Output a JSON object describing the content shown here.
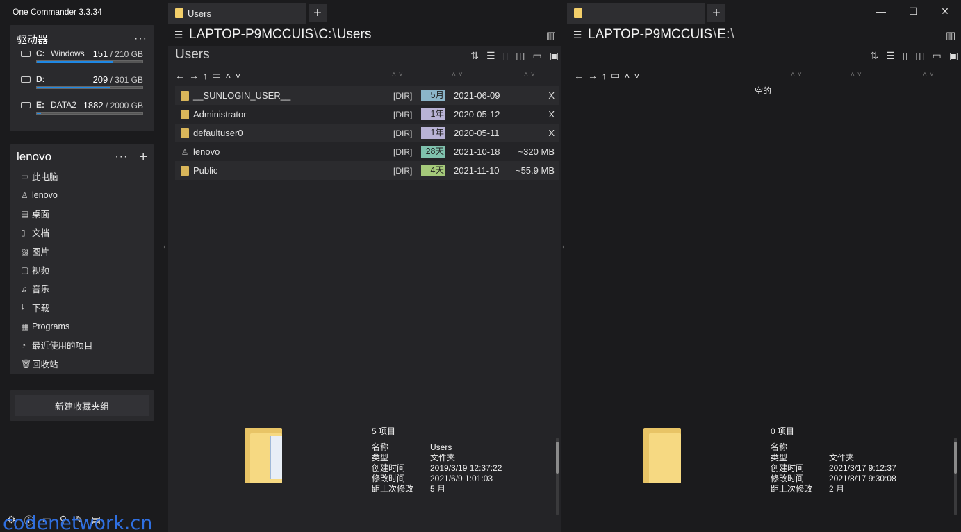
{
  "app": {
    "title": "One Commander 3.3.34"
  },
  "window_controls": {
    "minimize": "—",
    "maximize": "☐",
    "close": "✕"
  },
  "sidebar": {
    "drives_title": "驱动器",
    "drives_menu": "···",
    "drives": [
      {
        "letter": "C:",
        "label": "Windows",
        "used": "151",
        "total": "/ 210 GB",
        "fill": 0.72
      },
      {
        "letter": "D:",
        "label": "",
        "used": "209",
        "total": "/ 301 GB",
        "fill": 0.69
      },
      {
        "letter": "E:",
        "label": "DATA2",
        "used": "1882",
        "total": "/ 2000 GB",
        "fill": 0.04
      }
    ],
    "favorites_title": "lenovo",
    "favorites_menu": "···",
    "favorites_add": "+",
    "favorites": [
      {
        "icon": "computer-icon",
        "glyph": "▭",
        "label": "此电脑"
      },
      {
        "icon": "user-icon",
        "glyph": "♙",
        "label": "lenovo"
      },
      {
        "icon": "desktop-icon",
        "glyph": "▤",
        "label": "桌面"
      },
      {
        "icon": "document-icon",
        "glyph": "▯",
        "label": "文档"
      },
      {
        "icon": "picture-icon",
        "glyph": "▨",
        "label": "图片"
      },
      {
        "icon": "video-icon",
        "glyph": "▢",
        "label": "视频"
      },
      {
        "icon": "music-icon",
        "glyph": "♫",
        "label": "音乐"
      },
      {
        "icon": "download-icon",
        "glyph": "⤓",
        "label": "下载"
      },
      {
        "icon": "programs-icon",
        "glyph": "▦",
        "label": "Programs"
      },
      {
        "icon": "recent-icon",
        "glyph": "◔",
        "label": "最近使用的项目"
      },
      {
        "icon": "recycle-bin-icon",
        "glyph": "🗑",
        "label": "回收站"
      }
    ],
    "new_group": "新建收藏夹组"
  },
  "left_pane": {
    "tab_label": "Users",
    "tab_add": "+",
    "path_host": "LAPTOP-P9MCCUIS",
    "path_sep1": "\\",
    "path_drive": "C:",
    "path_sep2": "\\",
    "path_folder": "Users",
    "current_dir": "Users",
    "rows": [
      {
        "name": "__SUNLOGIN_USER__",
        "type": "[DIR]",
        "age": "5月",
        "age_color": "#8bb5c9",
        "date": "2021-06-09",
        "size": "X",
        "kind": "folder"
      },
      {
        "name": "Administrator",
        "type": "[DIR]",
        "age": "1年",
        "age_color": "#b9b3d6",
        "date": "2020-05-12",
        "size": "X",
        "kind": "folder"
      },
      {
        "name": "defaultuser0",
        "type": "[DIR]",
        "age": "1年",
        "age_color": "#b9b3d6",
        "date": "2020-05-11",
        "size": "X",
        "kind": "folder"
      },
      {
        "name": "lenovo",
        "type": "[DIR]",
        "age": "28天",
        "age_color": "#7fc1ad",
        "date": "2021-10-18",
        "size": "~320 MB",
        "kind": "user"
      },
      {
        "name": "Public",
        "type": "[DIR]",
        "age": "4天",
        "age_color": "#a5c97a",
        "date": "2021-11-10",
        "size": "~55.9 MB",
        "kind": "folder"
      }
    ],
    "item_count": "5 项目",
    "props": [
      {
        "k": "名称",
        "v": "Users"
      },
      {
        "k": "类型",
        "v": "文件夹"
      },
      {
        "k": "创建时间",
        "v": "2019/3/19 12:37:22"
      },
      {
        "k": "修改时间",
        "v": "2021/6/9 1:01:03"
      },
      {
        "k": "距上次修改",
        "v": "5 月"
      }
    ]
  },
  "right_pane": {
    "tab_label": "",
    "tab_add": "+",
    "path_host": "LAPTOP-P9MCCUIS",
    "path_sep1": "\\",
    "path_drive": "E:",
    "path_sep2": "\\",
    "empty_text": "空的",
    "item_count": "0 项目",
    "props": [
      {
        "k": "名称",
        "v": ""
      },
      {
        "k": "类型",
        "v": "文件夹"
      },
      {
        "k": "创建时间",
        "v": "2021/3/17 9:12:37"
      },
      {
        "k": "修改时间",
        "v": "2021/8/17 9:30:08"
      },
      {
        "k": "距上次修改",
        "v": "2 月"
      }
    ]
  },
  "watermark": "codenetwork.cn"
}
